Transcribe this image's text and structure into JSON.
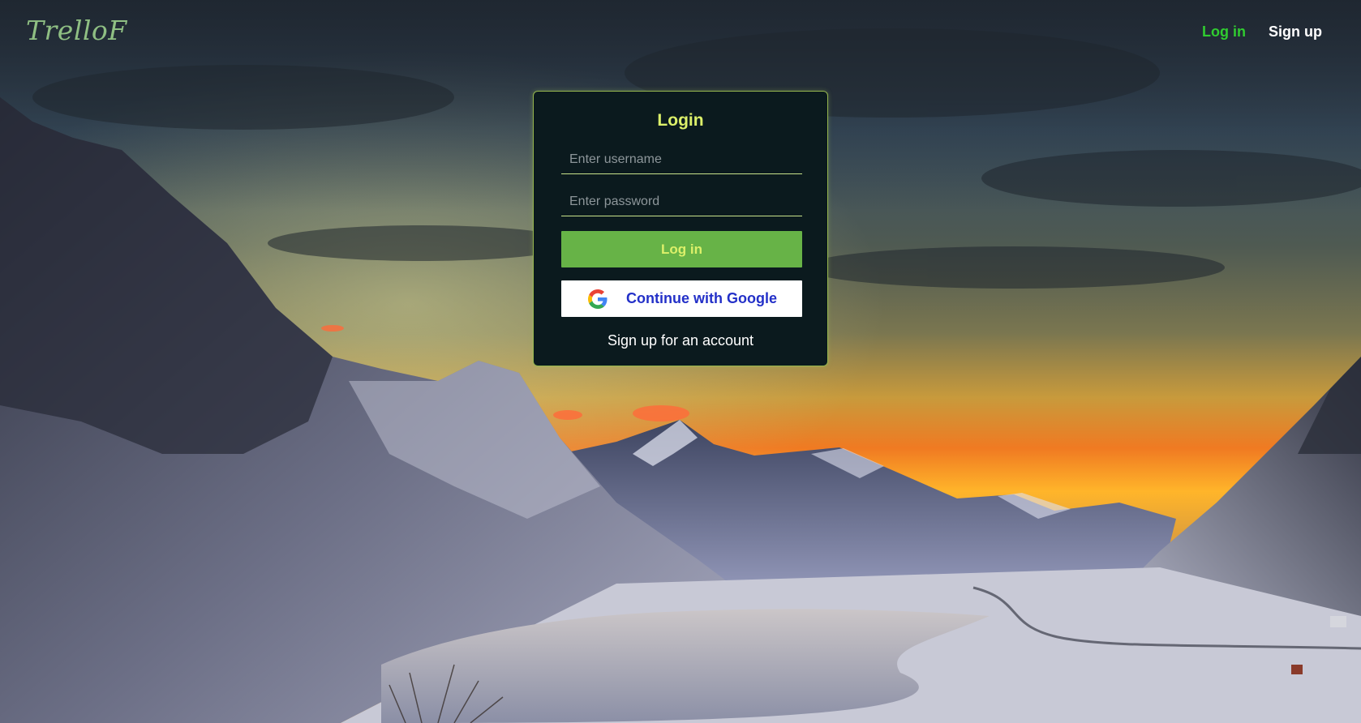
{
  "brand": {
    "logo": "TrelloF"
  },
  "nav": {
    "login_label": "Log in",
    "signup_label": "Sign up"
  },
  "login_card": {
    "title": "Login",
    "username_placeholder": "Enter username",
    "password_placeholder": "Enter password",
    "login_button": "Log in",
    "google_button": "Continue with Google",
    "signup_link": "Sign up for an account"
  },
  "colors": {
    "accent_green": "#30cc30",
    "title_yellow": "#dcf06a",
    "button_green": "#67b347",
    "google_text_blue": "#2330c8",
    "card_bg": "#0b1a1e"
  },
  "background": {
    "icon": "mountain-sunset-landscape"
  }
}
